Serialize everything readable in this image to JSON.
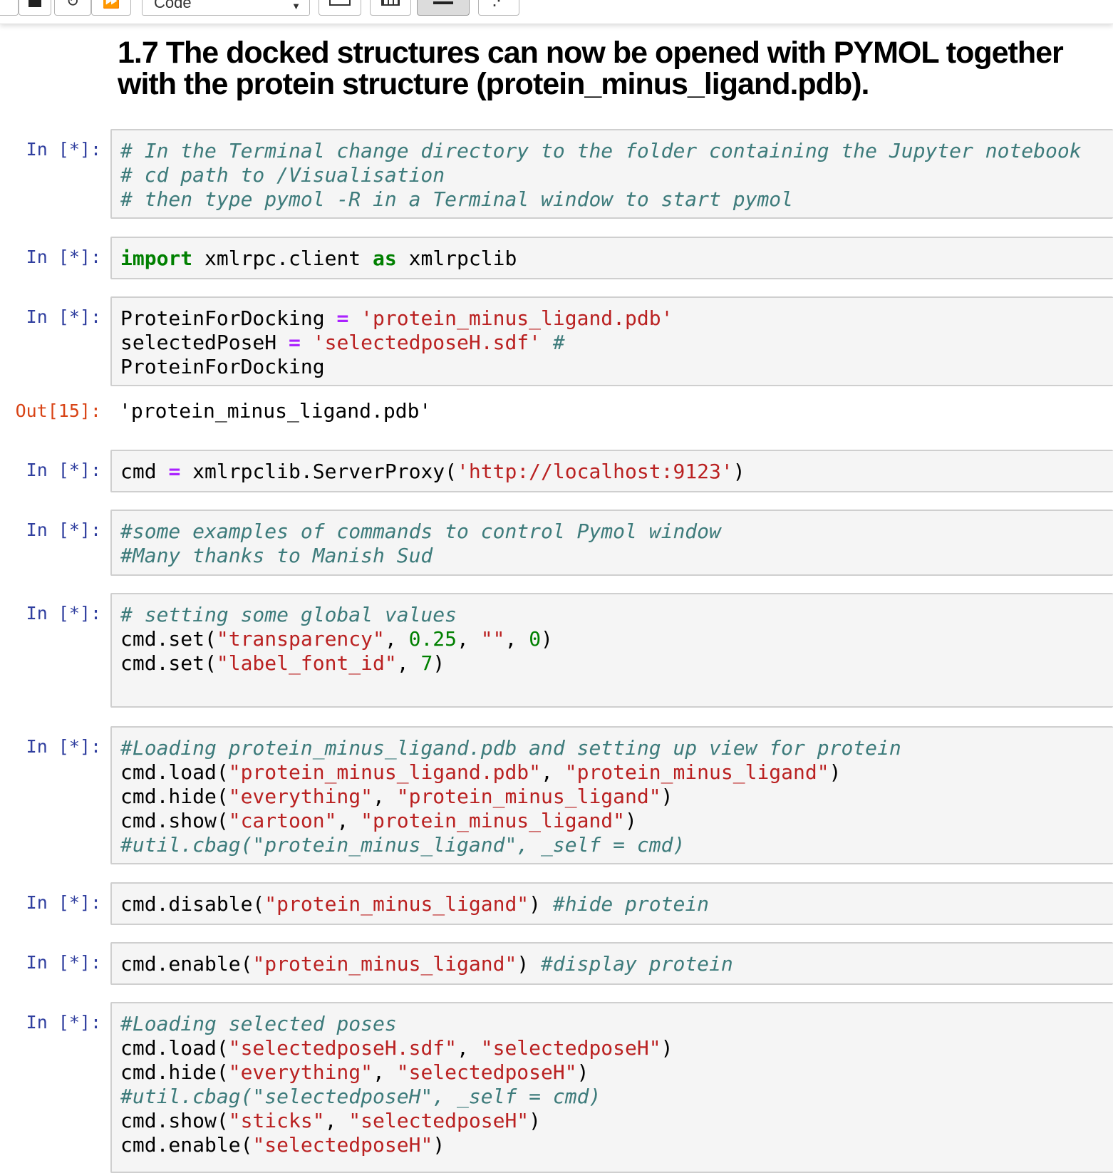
{
  "toolbar": {
    "cell_type": "Code",
    "icons": [
      "stop-icon",
      "restart-icon",
      "fast-forward-icon",
      "keyboard-icon",
      "grid-icon",
      "list-icon",
      "share-icon"
    ]
  },
  "heading": "1.7  The docked structures can now be opened with PYMOL together with the protein structure (protein_minus_ligand.pdb).",
  "cells": [
    {
      "prompt": "In [*]:",
      "lines": [
        [
          {
            "t": "c",
            "v": "# In the Terminal change directory to the folder containing the Jupyter notebook"
          }
        ],
        [
          {
            "t": "c",
            "v": "# cd path to /Visualisation"
          }
        ],
        [
          {
            "t": "c",
            "v": "# then type pymol -R in a Terminal window to start pymol"
          }
        ]
      ]
    },
    {
      "prompt": "In [*]:",
      "lines": [
        [
          {
            "t": "k",
            "v": "import"
          },
          {
            "t": "p",
            "v": " xmlrpc.client "
          },
          {
            "t": "k",
            "v": "as"
          },
          {
            "t": "p",
            "v": " xmlrpclib"
          }
        ]
      ]
    },
    {
      "prompt": "In [*]:",
      "lines": [
        [
          {
            "t": "p",
            "v": "ProteinForDocking "
          },
          {
            "t": "o",
            "v": "="
          },
          {
            "t": "p",
            "v": " "
          },
          {
            "t": "s",
            "v": "'protein_minus_ligand.pdb'"
          }
        ],
        [
          {
            "t": "p",
            "v": "selectedPoseH "
          },
          {
            "t": "o",
            "v": "="
          },
          {
            "t": "p",
            "v": " "
          },
          {
            "t": "s",
            "v": "'selectedposeH.sdf'"
          },
          {
            "t": "p",
            "v": " "
          },
          {
            "t": "c",
            "v": "#"
          }
        ],
        [
          {
            "t": "p",
            "v": "ProteinForDocking"
          }
        ]
      ]
    },
    {
      "prompt": "Out[15]:",
      "lines": [
        [
          {
            "t": "p",
            "v": "'protein_minus_ligand.pdb'"
          }
        ]
      ]
    },
    {
      "prompt": "In [*]:",
      "lines": [
        [
          {
            "t": "p",
            "v": "cmd "
          },
          {
            "t": "o",
            "v": "="
          },
          {
            "t": "p",
            "v": " xmlrpclib.ServerProxy("
          },
          {
            "t": "s",
            "v": "'http://localhost:9123'"
          },
          {
            "t": "p",
            "v": ")"
          }
        ]
      ]
    },
    {
      "prompt": "In [*]:",
      "lines": [
        [
          {
            "t": "c",
            "v": "#some examples of commands to control Pymol window"
          }
        ],
        [
          {
            "t": "c",
            "v": "#Many thanks to Manish Sud"
          }
        ]
      ]
    },
    {
      "prompt": "In [*]:",
      "lines": [
        [
          {
            "t": "c",
            "v": "# setting some global values"
          }
        ],
        [
          {
            "t": "p",
            "v": "cmd.set("
          },
          {
            "t": "s",
            "v": "\"transparency\""
          },
          {
            "t": "p",
            "v": ", "
          },
          {
            "t": "n",
            "v": "0.25"
          },
          {
            "t": "p",
            "v": ", "
          },
          {
            "t": "s",
            "v": "\"\""
          },
          {
            "t": "p",
            "v": ", "
          },
          {
            "t": "n",
            "v": "0"
          },
          {
            "t": "p",
            "v": ")"
          }
        ],
        [
          {
            "t": "p",
            "v": "cmd.set("
          },
          {
            "t": "s",
            "v": "\"label_font_id\""
          },
          {
            "t": "p",
            "v": ", "
          },
          {
            "t": "n",
            "v": "7"
          },
          {
            "t": "p",
            "v": ")"
          }
        ],
        [
          {
            "t": "p",
            "v": ""
          }
        ]
      ]
    },
    {
      "prompt": "In [*]:",
      "lines": [
        [
          {
            "t": "c",
            "v": "#Loading protein_minus_ligand.pdb and setting up view for protein"
          }
        ],
        [
          {
            "t": "p",
            "v": "cmd.load("
          },
          {
            "t": "s",
            "v": "\"protein_minus_ligand.pdb\""
          },
          {
            "t": "p",
            "v": ", "
          },
          {
            "t": "s",
            "v": "\"protein_minus_ligand\""
          },
          {
            "t": "p",
            "v": ")"
          }
        ],
        [
          {
            "t": "p",
            "v": "cmd.hide("
          },
          {
            "t": "s",
            "v": "\"everything\""
          },
          {
            "t": "p",
            "v": ", "
          },
          {
            "t": "s",
            "v": "\"protein_minus_ligand\""
          },
          {
            "t": "p",
            "v": ")"
          }
        ],
        [
          {
            "t": "p",
            "v": "cmd.show("
          },
          {
            "t": "s",
            "v": "\"cartoon\""
          },
          {
            "t": "p",
            "v": ", "
          },
          {
            "t": "s",
            "v": "\"protein_minus_ligand\""
          },
          {
            "t": "p",
            "v": ")"
          }
        ],
        [
          {
            "t": "c",
            "v": "#util.cbag(\"protein_minus_ligand\", _self = cmd)"
          }
        ]
      ]
    },
    {
      "prompt": "In [*]:",
      "lines": [
        [
          {
            "t": "p",
            "v": "cmd.disable("
          },
          {
            "t": "s",
            "v": "\"protein_minus_ligand\""
          },
          {
            "t": "p",
            "v": ") "
          },
          {
            "t": "c",
            "v": "#hide protein"
          }
        ]
      ]
    },
    {
      "prompt": "In [*]:",
      "lines": [
        [
          {
            "t": "p",
            "v": "cmd.enable("
          },
          {
            "t": "s",
            "v": "\"protein_minus_ligand\""
          },
          {
            "t": "p",
            "v": ") "
          },
          {
            "t": "c",
            "v": "#display protein"
          }
        ]
      ]
    },
    {
      "prompt": "In [*]:",
      "lines": [
        [
          {
            "t": "c",
            "v": "#Loading selected poses"
          }
        ],
        [
          {
            "t": "p",
            "v": "cmd.load("
          },
          {
            "t": "s",
            "v": "\"selectedposeH.sdf\""
          },
          {
            "t": "p",
            "v": ", "
          },
          {
            "t": "s",
            "v": "\"selectedposeH\""
          },
          {
            "t": "p",
            "v": ")"
          }
        ],
        [
          {
            "t": "p",
            "v": "cmd.hide("
          },
          {
            "t": "s",
            "v": "\"everything\""
          },
          {
            "t": "p",
            "v": ", "
          },
          {
            "t": "s",
            "v": "\"selectedposeH\""
          },
          {
            "t": "p",
            "v": ")"
          }
        ],
        [
          {
            "t": "c",
            "v": "#util.cbag(\"selectedposeH\", _self = cmd)"
          }
        ],
        [
          {
            "t": "p",
            "v": "cmd.show("
          },
          {
            "t": "s",
            "v": "\"sticks\""
          },
          {
            "t": "p",
            "v": ", "
          },
          {
            "t": "s",
            "v": "\"selectedposeH\""
          },
          {
            "t": "p",
            "v": ")"
          }
        ],
        [
          {
            "t": "p",
            "v": "cmd.enable("
          },
          {
            "t": "s",
            "v": "\"selectedposeH\""
          },
          {
            "t": "p",
            "v": ")"
          }
        ]
      ]
    }
  ]
}
